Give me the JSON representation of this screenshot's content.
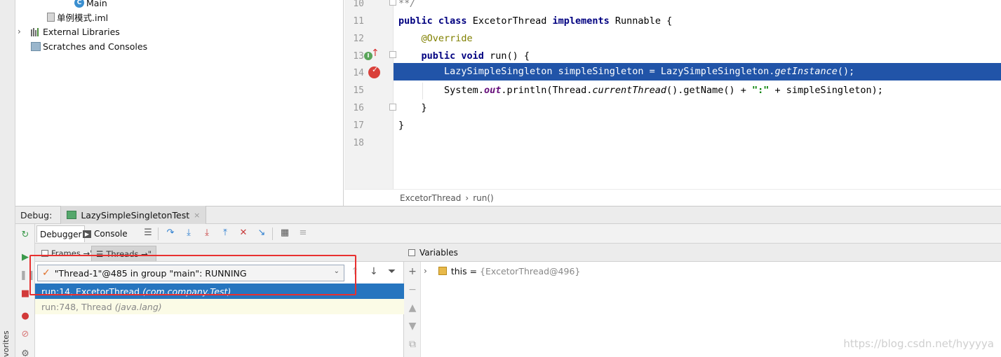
{
  "project_tree": {
    "items": [
      {
        "label": "Main",
        "icon": "class-icon",
        "icon_char": "C"
      },
      {
        "label": "单例模式.iml",
        "icon": "module-file-icon"
      },
      {
        "label": "External Libraries",
        "icon": "libraries-icon"
      },
      {
        "label": "Scratches and Consoles",
        "icon": "scratches-icon"
      }
    ]
  },
  "editor": {
    "lines": [
      {
        "num": "10"
      },
      {
        "num": "11"
      },
      {
        "num": "12"
      },
      {
        "num": "13"
      },
      {
        "num": "14"
      },
      {
        "num": "15"
      },
      {
        "num": "16"
      },
      {
        "num": "17"
      },
      {
        "num": "18"
      }
    ],
    "code": {
      "l10": "**/",
      "l11_kw": "public class",
      "l11_name": "ExcetorThread",
      "l11_impl": "implements",
      "l11_rest": "Runnable {",
      "l12": "@Override",
      "l13_kw": "public void",
      "l13_rest": "run() {",
      "l14_a": "LazySimpleSingleton simpleSingleton = LazySimpleSingleton.",
      "l14_b": "getInstance",
      "l14_c": "();",
      "l15_a": "System.",
      "l15_b": "out",
      "l15_c": ".println(Thread.",
      "l15_d": "currentThread",
      "l15_e": "().getName() + ",
      "l15_f": "\":\"",
      "l15_g": " + simpleSingleton);",
      "l16": "}",
      "l17": "}"
    },
    "breadcrumb": [
      "ExcetorThread",
      "run()"
    ],
    "breadcrumb_sep": "›"
  },
  "debug": {
    "label": "Debug:",
    "tab_label": "LazySimpleSingletonTest",
    "tab_close": "×",
    "toolbar_tabs": {
      "debugger": "Debugger",
      "console": "Console"
    },
    "frames_tabs": {
      "frames": "Frames →\"",
      "threads": "Threads →\""
    },
    "thread_selected": "\"Thread-1\"@485 in group \"main\": RUNNING",
    "frames": [
      {
        "location": "run:14, ExcetorThread",
        "package": "(com.company.Test)"
      },
      {
        "location": "run:748, Thread",
        "package": "(java.lang)"
      }
    ],
    "variables_title": "Variables",
    "variables": [
      {
        "name": "this",
        "eq": " = ",
        "value": "{ExcetorThread@496}"
      }
    ]
  },
  "colors": {
    "highlight_line": "#2154a8",
    "selected_frame": "#2675bf",
    "annotation_box": "#e8302f"
  },
  "sidebar": {
    "favorites_label": "vorites"
  },
  "watermark": "https://blog.csdn.net/hyyyya"
}
